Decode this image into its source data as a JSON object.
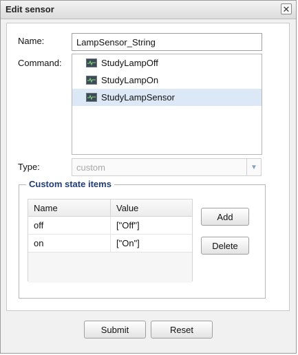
{
  "dialog": {
    "title": "Edit sensor"
  },
  "form": {
    "name_label": "Name:",
    "name_value": "LampSensor_String",
    "command_label": "Command:",
    "commands": [
      {
        "label": "StudyLampOff",
        "selected": false
      },
      {
        "label": "StudyLampOn",
        "selected": false
      },
      {
        "label": "StudyLampSensor",
        "selected": true
      }
    ],
    "type_label": "Type:",
    "type_value": "custom"
  },
  "custom_state": {
    "legend": "Custom state items",
    "columns": [
      "Name",
      "Value"
    ],
    "rows": [
      {
        "name": "off",
        "value": "[\"Off\"]"
      },
      {
        "name": "on",
        "value": "[\"On\"]"
      }
    ],
    "add_label": "Add",
    "delete_label": "Delete"
  },
  "footer": {
    "submit_label": "Submit",
    "reset_label": "Reset"
  },
  "colors": {
    "selection": "#dde8f6",
    "legend": "#1f3c78"
  }
}
